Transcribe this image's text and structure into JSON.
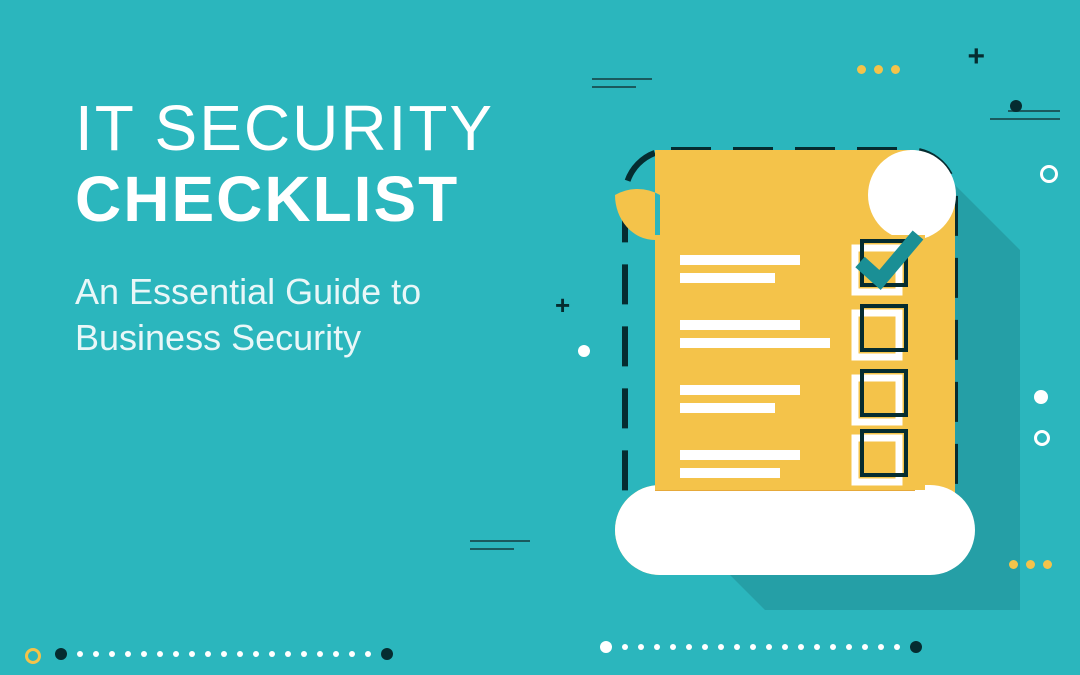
{
  "title": {
    "line1": "IT SECURITY",
    "line2": "CHECKLIST"
  },
  "subtitle": {
    "line1": "An Essential Guide to",
    "line2": "Business Security"
  },
  "colors": {
    "background": "#2bb6bd",
    "accent": "#f4c34a",
    "dark": "#052c30",
    "white": "#ffffff"
  }
}
